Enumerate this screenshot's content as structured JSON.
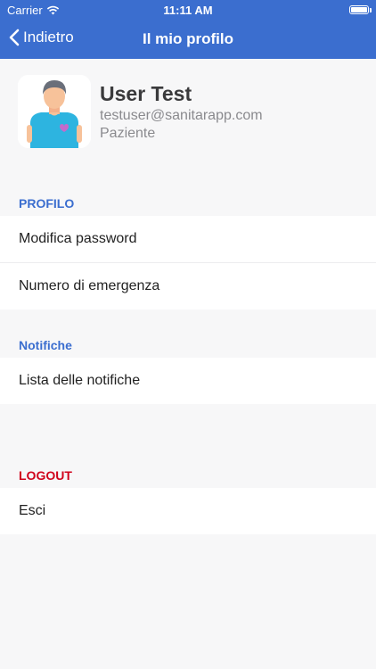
{
  "status_bar": {
    "carrier": "Carrier",
    "time": "11:11 AM",
    "icons": [
      "wifi-icon",
      "battery-icon"
    ]
  },
  "nav": {
    "back_label": "Indietro",
    "title": "Il mio profilo"
  },
  "profile": {
    "name": "User Test",
    "email": "testuser@sanitarapp.com",
    "role": "Paziente"
  },
  "sections": {
    "profilo": {
      "header": "PROFILO",
      "header_color": "#3b6ecf",
      "items": [
        "Modifica password",
        "Numero di emergenza"
      ]
    },
    "notifiche": {
      "header": "Notifiche",
      "header_color": "#3b6ecf",
      "items": [
        "Lista delle notifiche"
      ]
    },
    "logout": {
      "header": "LOGOUT",
      "header_color": "#d0021b",
      "items": [
        "Esci"
      ]
    }
  },
  "colors": {
    "nav_background": "#3b6ecf",
    "page_background": "#f7f7f8"
  }
}
